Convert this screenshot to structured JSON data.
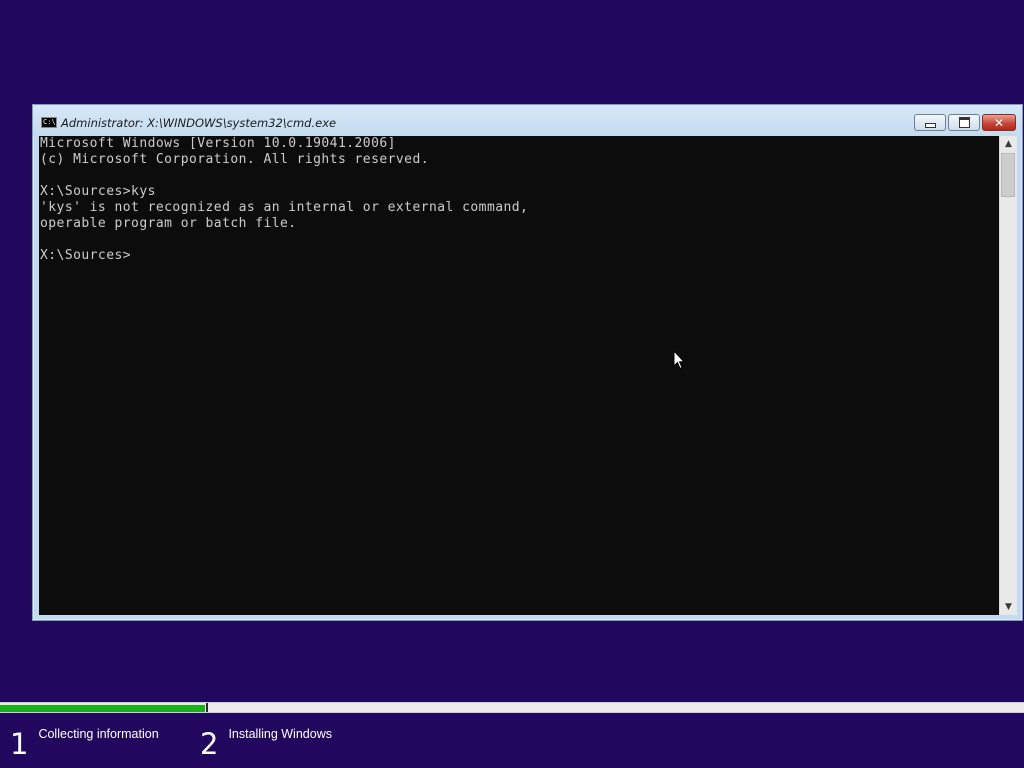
{
  "window": {
    "title": "Administrator: X:\\WINDOWS\\system32\\cmd.exe",
    "icon_text": "C:\\",
    "buttons": {
      "minimize": "minimize",
      "maximize": "maximize",
      "close": "✕"
    }
  },
  "console": {
    "lines": [
      "Microsoft Windows [Version 10.0.19041.2006]",
      "(c) Microsoft Corporation. All rights reserved.",
      "",
      "X:\\Sources>kys",
      "'kys' is not recognized as an internal or external command,",
      "operable program or batch file.",
      "",
      "X:\\Sources>"
    ],
    "scroll_up_icon": "▲",
    "scroll_down_icon": "▼"
  },
  "setup": {
    "progress_fraction": 0.2,
    "steps": [
      {
        "number": "1",
        "label": "Collecting information"
      },
      {
        "number": "2",
        "label": "Installing Windows"
      }
    ]
  },
  "colors": {
    "desktop_background": "#22075e",
    "console_background": "#0c0c0c",
    "console_text": "#cccccc",
    "progress_fill": "#19b11b"
  },
  "icons": {
    "app": "cmd-icon",
    "minimize": "minimize-icon",
    "maximize": "maximize-icon",
    "close": "close-icon",
    "cursor": "mouse-pointer-icon"
  }
}
